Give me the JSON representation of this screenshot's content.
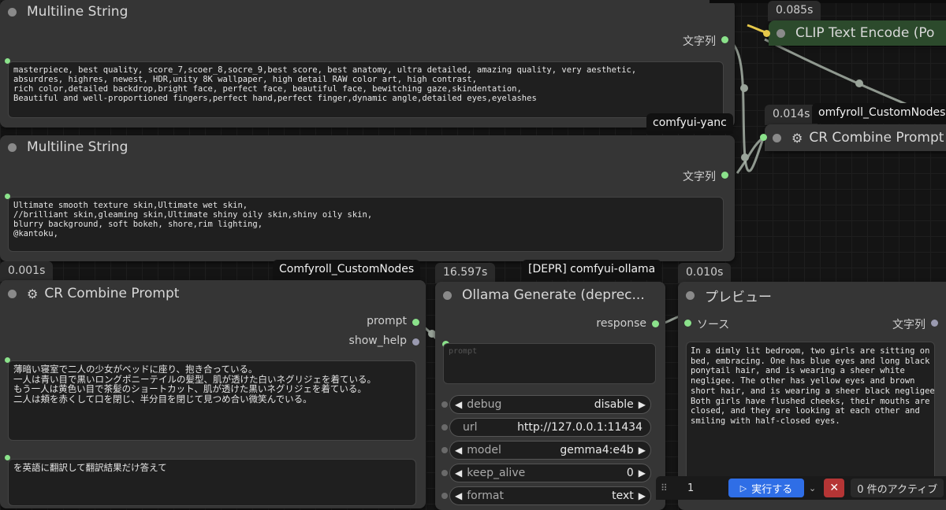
{
  "nodes": {
    "ms1": {
      "title": "Multiline String",
      "output_label": "文字列",
      "text": "masterpiece, best quality, score_7,scoer_8,socre_9,best score, best anatomy, ultra detailed, amazing quality, very aesthetic,\nabsurdres, highres, newest, HDR,unity 8K wallpaper, high detail RAW color art, high contrast,\nrich color,detailed backdrop,bright face, perfect face, beautiful face, bewitching gaze,skindentation,\nBeautiful and well-proportioned fingers,perfect hand,perfect finger,dynamic angle,detailed eyes,eyelashes",
      "tag": "comfyui-yanc"
    },
    "ms2": {
      "title": "Multiline String",
      "output_label": "文字列",
      "text": "Ultimate smooth texture skin,Ultimate wet skin,\n//brilliant skin,gleaming skin,Ultimate shiny oily skin,shiny oily skin,\nblurry background, soft bokeh, shore,rim lighting,\n@kantoku,"
    },
    "clip": {
      "title": "CLIP Text Encode (Po",
      "badge": "0.085s"
    },
    "cr_right": {
      "title": "CR Combine Prompt",
      "badge": "0.014s",
      "tag": "omfyroll_CustomNodes"
    },
    "cr_left": {
      "title": "CR Combine Prompt",
      "badge": "0.001s",
      "tag": "Comfyroll_CustomNodes",
      "output1": "prompt",
      "output2": "show_help",
      "text1": "薄暗い寝室で二人の少女がベッドに座り、抱き合っている。\n一人は青い目で黒いロングポニーテイルの髪型、肌が透けた白いネグリジェを着ている。\nもう一人は黄色い目で茶髪のショートカット、肌が透けた黒いネグリジェを着ている。\n二人は頬を赤くして口を閉じ、半分目を閉じて見つめ合い微笑んでいる。",
      "text2": "を英語に翻訳して翻訳結果だけ答えて"
    },
    "ollama": {
      "title": "Ollama Generate (deprec...",
      "badge": "16.597s",
      "tag": "[DEPR] comfyui-ollama",
      "output": "response",
      "prompt_placeholder": "prompt",
      "widgets": [
        {
          "label": "debug",
          "value": "disable"
        },
        {
          "label": "url",
          "value": "http://127.0.0.1:11434"
        },
        {
          "label": "model",
          "value": "gemma4:e4b"
        },
        {
          "label": "keep_alive",
          "value": "0"
        },
        {
          "label": "format",
          "value": "text"
        }
      ]
    },
    "preview": {
      "title": "プレビュー",
      "badge": "0.010s",
      "input": "ソース",
      "output": "文字列",
      "text": "In a dimly lit bedroom, two girls are sitting on a\nbed, embracing. One has blue eyes and long black\nponytail hair, and is wearing a sheer white\nnegligee. The other has yellow eyes and brown\nshort hair, and is wearing a sheer black negligee.\nBoth girls have flushed cheeks, their mouths are\nclosed, and they are looking at each other and\nsmiling with half-closed eyes."
    }
  },
  "toolbar": {
    "batch_count": "1",
    "run_label": "実行する",
    "queue_label": "0 件のアクティブ"
  },
  "colors": {
    "accent": "#2f6ee6",
    "slot_green": "#8be28b",
    "cancel": "#b53535"
  }
}
